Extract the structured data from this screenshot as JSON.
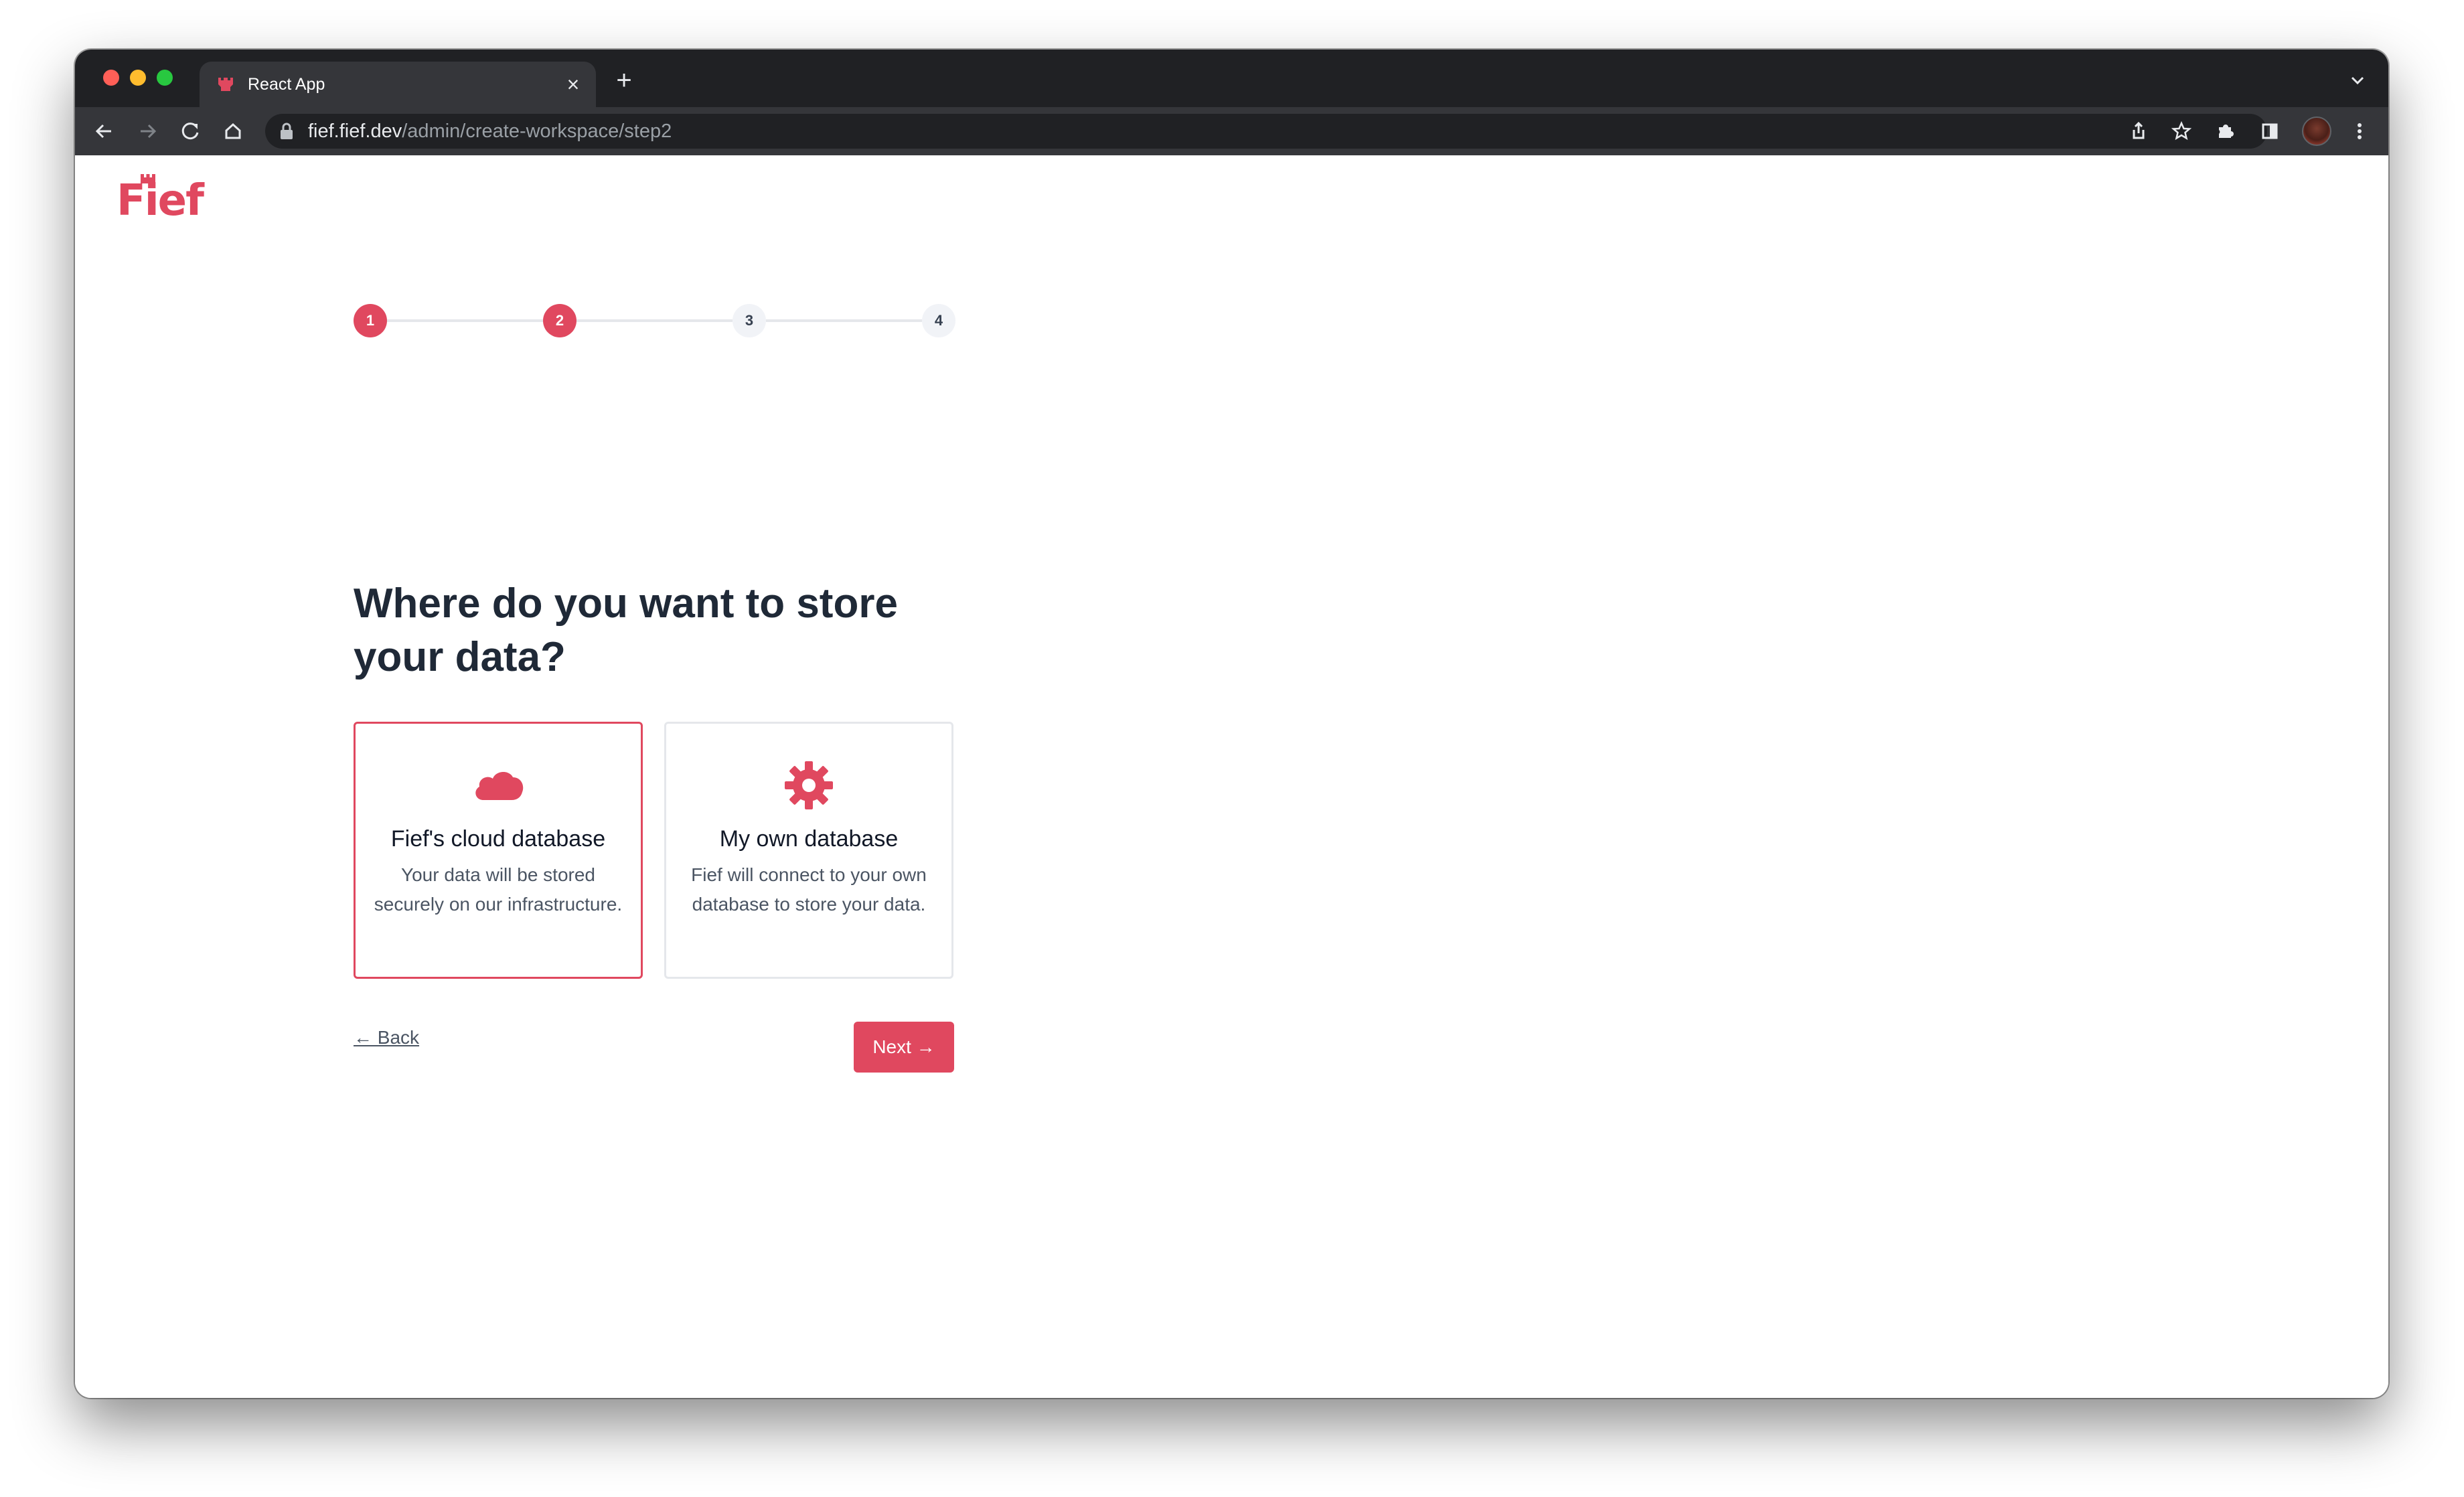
{
  "browser": {
    "tab_title": "React App",
    "tab_close": "×",
    "new_tab": "+",
    "url_host": "fief.fief.dev",
    "url_path": "/admin/create-workspace/step2"
  },
  "app": {
    "logo_text": "Fief",
    "brand_color": "#e0485f"
  },
  "stepper": {
    "steps": [
      {
        "label": "1",
        "state": "done"
      },
      {
        "label": "2",
        "state": "done"
      },
      {
        "label": "3",
        "state": "todo"
      },
      {
        "label": "4",
        "state": "todo"
      }
    ]
  },
  "main": {
    "heading": "Where do you want to store your data?",
    "options": [
      {
        "icon": "cloud-icon",
        "title": "Fief's cloud database",
        "description": "Your data will be stored securely on our infrastructure.",
        "selected": true
      },
      {
        "icon": "gear-icon",
        "title": "My own database",
        "description": "Fief will connect to your own database to store your data.",
        "selected": false
      }
    ],
    "back_label": "← Back",
    "next_label": "Next →"
  }
}
